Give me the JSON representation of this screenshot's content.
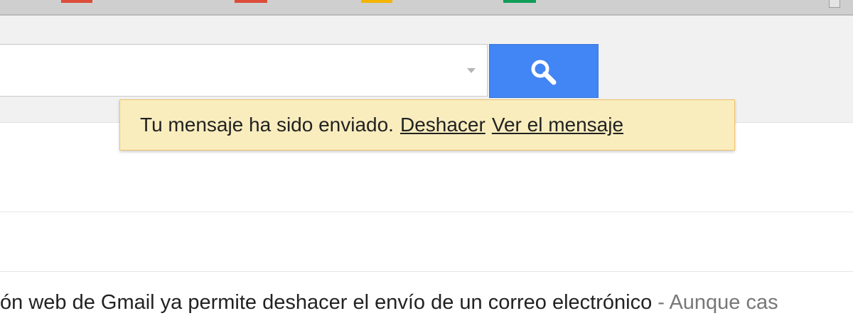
{
  "browser": {
    "tab_marks": [
      {
        "color": "#dd4b39"
      },
      {
        "color": "#dd4b39"
      },
      {
        "color": "#f4b400"
      },
      {
        "color": "#0f9d58"
      }
    ]
  },
  "search": {
    "value": "",
    "button_icon": "search-icon",
    "button_color": "#4285f4"
  },
  "notification": {
    "message": "Tu mensaje ha sido enviado.",
    "undo_label": "Deshacer",
    "view_label": "Ver el mensaje",
    "background": "#f9edbe",
    "border": "#f0c36d"
  },
  "email_row": {
    "subject": "ón web de Gmail ya permite deshacer el envío de un correo electrónico",
    "separator": "-",
    "preview": "Aunque cas"
  }
}
